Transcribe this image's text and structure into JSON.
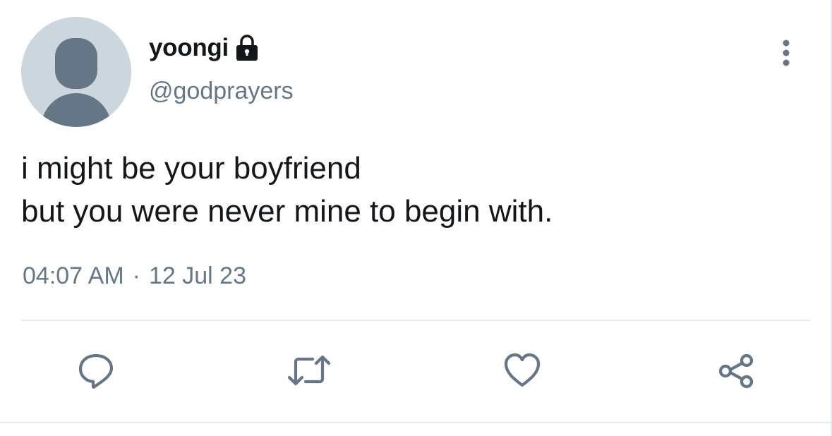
{
  "user": {
    "display_name": "yoongi",
    "handle": "@godprayers",
    "protected_icon": "lock-icon",
    "avatar_icon": "default-avatar-icon"
  },
  "tweet": {
    "text": "i might be your boyfriend\nbut you were never mine to begin with.",
    "time": "04:07 AM",
    "separator": "·",
    "date": "12 Jul 23"
  },
  "actions": {
    "reply_icon": "reply-icon",
    "retweet_icon": "retweet-icon",
    "like_icon": "heart-icon",
    "share_icon": "share-icon",
    "more_icon": "more-vertical-icon"
  },
  "colors": {
    "text_primary": "#14171a",
    "text_secondary": "#657786",
    "avatar_bg": "#ccd6dd",
    "avatar_fg": "#657786",
    "divider": "#e6ecf0"
  }
}
